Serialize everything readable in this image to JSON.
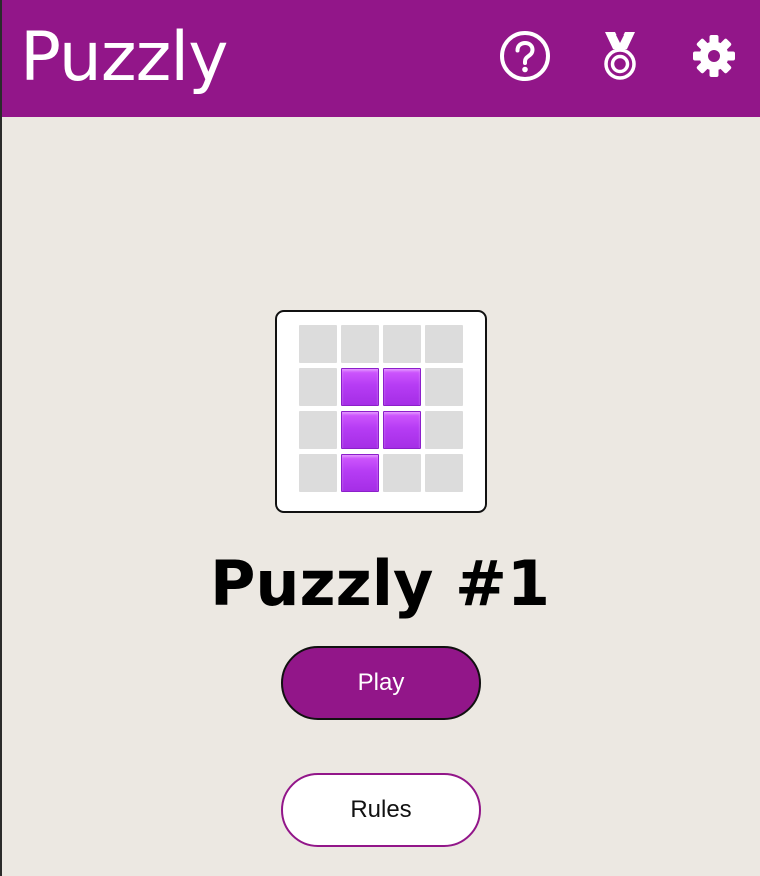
{
  "header": {
    "title": "Puzzly",
    "background_color": "#921689",
    "icons": [
      "help-circle-icon",
      "medal-icon",
      "gear-icon"
    ]
  },
  "logo": {
    "grid": [
      [
        0,
        0,
        0,
        0
      ],
      [
        0,
        1,
        1,
        0
      ],
      [
        0,
        1,
        1,
        0
      ],
      [
        0,
        1,
        0,
        0
      ]
    ],
    "filled_color": "#b63cf4",
    "empty_color": "#dcdcdc"
  },
  "main": {
    "puzzle_title": "Puzzly #1",
    "play_label": "Play",
    "rules_label": "Rules"
  },
  "colors": {
    "page_background": "#ece8e2",
    "accent": "#921689"
  }
}
